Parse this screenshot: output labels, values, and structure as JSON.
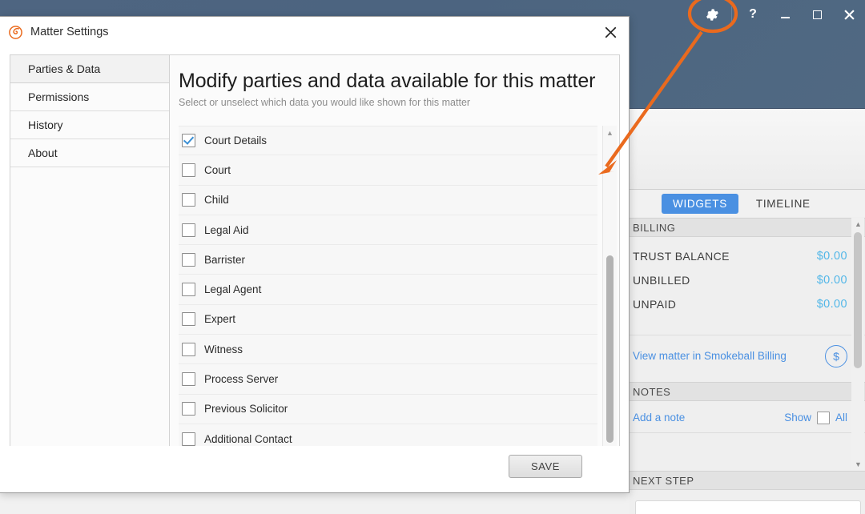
{
  "colors": {
    "accent_orange": "#ea6a1e",
    "titlebar": "#4e6581",
    "tab_active": "#4a90e2",
    "link_blue": "#4a90e2",
    "amount_blue": "#53b7e8",
    "checkmark_blue": "#3b8fd4"
  },
  "background_window": {
    "title_bar": {
      "buttons": [
        {
          "name": "settings-gear",
          "icon": "gear-icon",
          "label": ""
        },
        {
          "name": "help",
          "icon": "question-mark-icon",
          "label": "?"
        },
        {
          "name": "minimize",
          "icon": "minimize-icon",
          "label": "–"
        },
        {
          "name": "maximize",
          "icon": "maximize-icon",
          "label": "☐"
        },
        {
          "name": "close",
          "icon": "close-icon",
          "label": "✕"
        }
      ]
    },
    "tabs": [
      {
        "label": "WIDGETS",
        "active": true
      },
      {
        "label": "TIMELINE",
        "active": false
      }
    ],
    "billing": {
      "section_label": "BILLING",
      "rows": [
        {
          "label": "TRUST BALANCE",
          "amount": "$0.00"
        },
        {
          "label": "UNBILLED",
          "amount": "$0.00"
        },
        {
          "label": "UNPAID",
          "amount": "$0.00"
        }
      ],
      "view_matter_link": "View matter in Smokeball Billing",
      "dollar_icon": "dollar-circle-icon"
    },
    "notes": {
      "section_label": "NOTES",
      "add_note_link": "Add a note",
      "show_label": "Show",
      "all_label": "All"
    },
    "next_step": {
      "section_label": "NEXT STEP"
    }
  },
  "dialog": {
    "title": "Matter Settings",
    "logo_icon": "smokeball-logo-icon",
    "close_icon": "close-icon",
    "sidebar": {
      "items": [
        {
          "label": "Parties & Data",
          "selected": true
        },
        {
          "label": "Permissions",
          "selected": false
        },
        {
          "label": "History",
          "selected": false
        },
        {
          "label": "About",
          "selected": false
        }
      ]
    },
    "content": {
      "title": "Modify parties and data available for this matter",
      "subtitle": "Select or unselect which data you would like shown for this matter",
      "items": [
        {
          "label": "Court Details",
          "checked": true
        },
        {
          "label": "Court",
          "checked": false
        },
        {
          "label": "Child",
          "checked": false
        },
        {
          "label": "Legal Aid",
          "checked": false
        },
        {
          "label": "Barrister",
          "checked": false
        },
        {
          "label": "Legal Agent",
          "checked": false
        },
        {
          "label": "Expert",
          "checked": false
        },
        {
          "label": "Witness",
          "checked": false
        },
        {
          "label": "Process Server",
          "checked": false
        },
        {
          "label": "Previous Solicitor",
          "checked": false
        },
        {
          "label": "Additional Contact",
          "checked": false
        }
      ]
    },
    "footer": {
      "save_label": "SAVE"
    }
  },
  "annotation": {
    "type": "arrow-with-ellipse",
    "color": "#ea6a1e",
    "highlight_target": "settings-gear-icon"
  }
}
